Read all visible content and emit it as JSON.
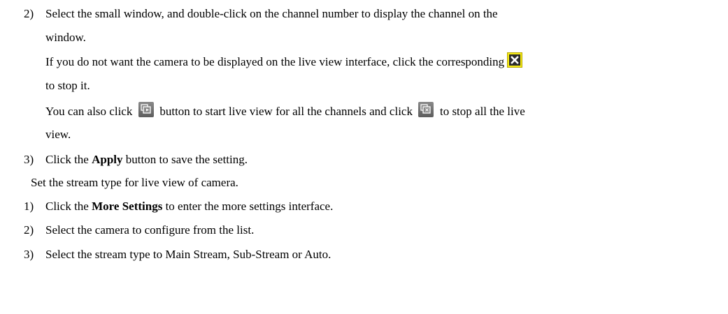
{
  "steps_a": [
    {
      "number": "2)",
      "line1": "Select the small window, and double-click on the channel number to display the channel on the",
      "line2": "window."
    }
  ],
  "note_stop": {
    "line1_pre": "If you do not want the camera to be displayed on the live view interface, click the corresponding",
    "line2": "to stop it."
  },
  "note_all": {
    "part1": "You can also click",
    "part2": "button to start live view for all the channels and click",
    "part3": "to stop all the live",
    "line2": "view."
  },
  "step_apply": {
    "number": "3)",
    "pre": "Click the",
    "bold": "Apply",
    "post": "button to save the setting."
  },
  "intro_stream": "Set the stream type for live view of camera.",
  "steps_b": [
    {
      "number": "1)",
      "pre": "Click the",
      "bold": "More Settings",
      "post": "to enter the more settings interface."
    },
    {
      "number": "2)",
      "text": "Select the camera to configure from the list."
    },
    {
      "number": "3)",
      "text": "Select the stream type to Main Stream, Sub-Stream or Auto."
    }
  ],
  "icons": {
    "close": "close-icon",
    "start_all": "start-all-live-view-icon",
    "stop_all": "stop-all-live-view-icon"
  },
  "colors": {
    "close_icon_bg": "#f4ea17",
    "live_icon_bg": "#6f6f6f"
  }
}
